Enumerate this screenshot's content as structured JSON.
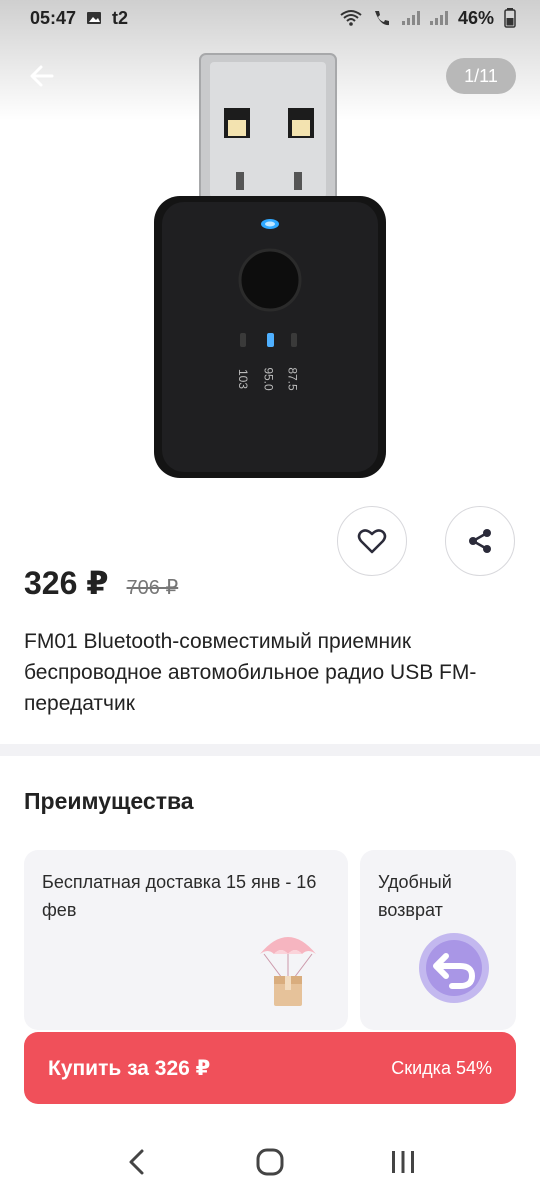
{
  "status_bar": {
    "time": "05:47",
    "carrier": "t2",
    "battery": "46%",
    "icons": [
      "image-icon",
      "wifi-icon",
      "wifi-call-icon",
      "signal-icon",
      "battery-icon"
    ]
  },
  "gallery": {
    "counter": "1/11",
    "image_labels": [
      "103",
      "95.0",
      "87.5"
    ]
  },
  "product": {
    "price": "326 ₽",
    "old_price": "706 ₽",
    "title": "FM01 Bluetooth-совместимый приемник беспроводное автомобильное радио USB FM-передатчик"
  },
  "advantages": {
    "title": "Преимущества",
    "cards": [
      {
        "text": "Бесплатная доставка 15 янв - 16 фев",
        "icon": "parcel-parachute-icon"
      },
      {
        "text": "Удобный возврат",
        "icon": "return-arrow-icon"
      }
    ]
  },
  "buy_bar": {
    "label": "Купить за 326 ₽",
    "discount": "Скидка 54%"
  },
  "colors": {
    "accent": "#f0505a",
    "card_bg": "#f4f4f7"
  }
}
